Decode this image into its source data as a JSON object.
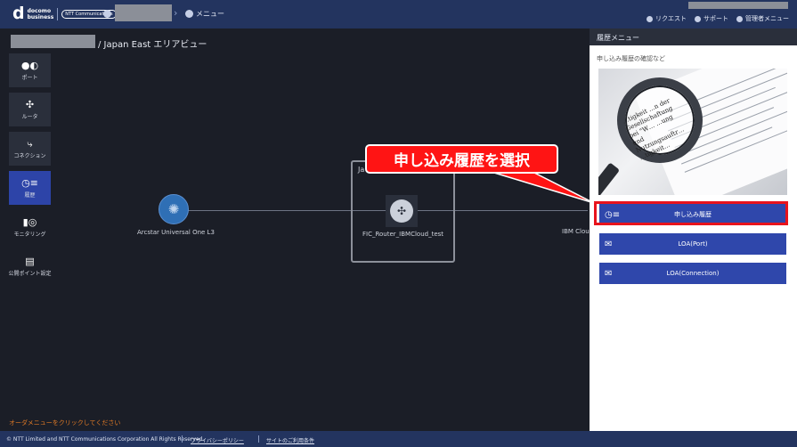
{
  "header": {
    "logo_main": "d",
    "logo_text_line1": "docomo",
    "logo_text_line2": "business",
    "logo_ntt": "NTT Communications",
    "breadcrumb_menu": "メニュー",
    "request_label": "リクエスト",
    "support_label": "サポート",
    "admin_label": "管理者メニュー"
  },
  "page": {
    "title_suffix": "/ Japan East エリアビュー"
  },
  "left_menu": {
    "items": [
      {
        "icon": "●◐",
        "label": "ポート"
      },
      {
        "icon": "✣",
        "label": "ルータ"
      },
      {
        "icon": "⤷",
        "label": "コネクション"
      },
      {
        "icon": "◷≡",
        "label": "履歴",
        "active": true
      },
      {
        "icon": "▮◎",
        "label": "モニタリング"
      },
      {
        "icon": "▤",
        "label": "公開ポイント設定"
      }
    ]
  },
  "canvas": {
    "node1_label": "Arcstar Universal One L3",
    "area_label": "Ja",
    "router_label": "FIC_Router_IBMCloud_test",
    "ibm_label": "IBM Cloud",
    "hint": "オーダメニューをクリックしてください"
  },
  "right_panel": {
    "title": "履歴メニュー",
    "subtitle": "申し込み履歴の確認など",
    "image_text": "…tigkeit\n…n der Gesellschaftung bei \"W…\n…ung und Nutzungsauftr…\n…tigkeit…",
    "buttons": [
      {
        "label": "申し込み履歴",
        "icon": "◷≡"
      },
      {
        "label": "LOA(Port)",
        "icon": "✉"
      },
      {
        "label": "LOA(Connection)",
        "icon": "✉"
      }
    ]
  },
  "callout": {
    "text": "申し込み履歴を選択"
  },
  "footer": {
    "copyright": "© NTT Limited and NTT Communications Corporation All Rights Reserved.",
    "privacy": "プライバシーポリシー",
    "terms": "サイトのご利用条件"
  },
  "colors": {
    "header_bg": "#23345f",
    "canvas_bg": "#1b1e27",
    "button_bg": "#2f47ab",
    "callout_bg": "#ff1414",
    "highlight_border": "#e8131c",
    "hint_text": "#e07a26"
  }
}
